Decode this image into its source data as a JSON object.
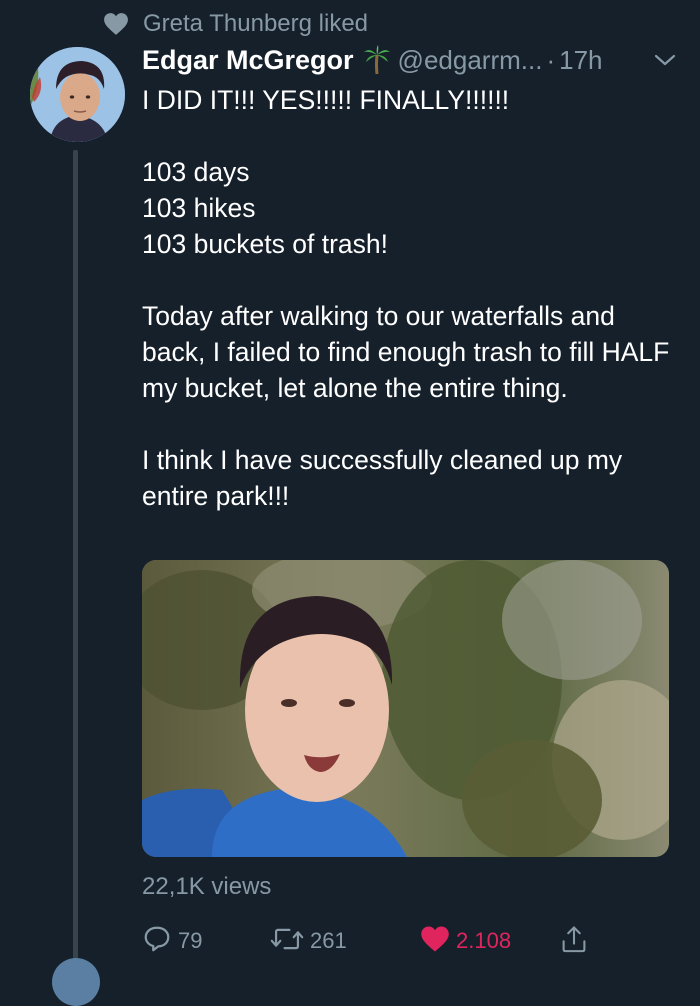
{
  "social_context": {
    "icon": "heart-icon",
    "text": "Greta Thunberg liked"
  },
  "tweet": {
    "author": {
      "display_name": "Edgar McGregor",
      "emoji": "palm-tree-icon",
      "handle": "@edgarrm...",
      "separator": "·",
      "time": "17h"
    },
    "text_blocks": [
      "I DID IT!!! YES!!!!! FINALLY!!!!!!",
      "",
      "103 days",
      "103 hikes",
      "103 buckets of trash!",
      "",
      "Today after walking to our waterfalls and back, I failed to find enough trash to fill HALF my bucket, let alone the entire thing.",
      "",
      "I think I have successfully cleaned up my entire park!!!"
    ],
    "media": {
      "type": "video-thumbnail"
    },
    "views": "22,1K views",
    "actions": {
      "reply": {
        "icon": "reply-icon",
        "count": "79"
      },
      "retweet": {
        "icon": "retweet-icon",
        "count": "261"
      },
      "like": {
        "icon": "heart-filled-icon",
        "count": "2.108",
        "liked": true
      },
      "share": {
        "icon": "share-icon"
      }
    }
  },
  "colors": {
    "background": "#15202b",
    "secondary_text": "#8899a6",
    "like_active": "#e0245e",
    "thread_line": "#38444d"
  }
}
